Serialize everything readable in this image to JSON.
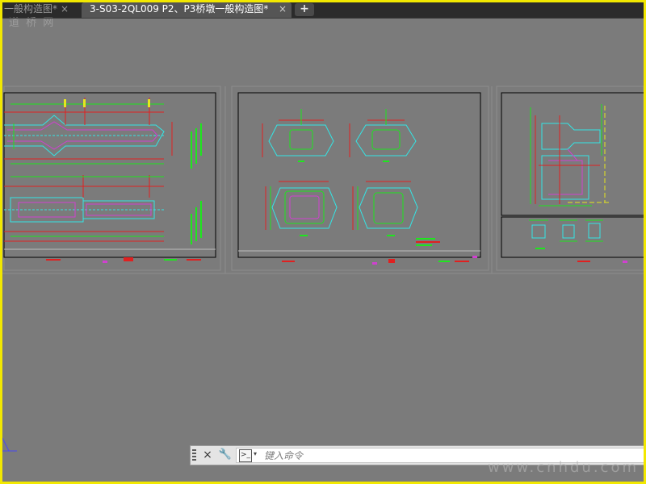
{
  "tabs": [
    {
      "label": "一般构造图*",
      "close": "×"
    },
    {
      "label": "3-S03-2QL009 P2、P3桥墩一般构造图*",
      "close": "×"
    }
  ],
  "add_tab_label": "+",
  "watermark_top": "道 桥 网",
  "watermark_bottom": "www.cnhdu.com",
  "command_line": {
    "close_icon": "×",
    "tool_icon": "🔧",
    "prompt_icon": ">_",
    "dropdown": "▾",
    "placeholder": "键入命令"
  },
  "colors": {
    "frame": "#f2e800",
    "canvas": "#7b7b7b",
    "cyan": "#33e6e6",
    "green": "#1ee61e",
    "red": "#e02020",
    "yellow": "#e6e61e",
    "magenta": "#d040d0"
  }
}
